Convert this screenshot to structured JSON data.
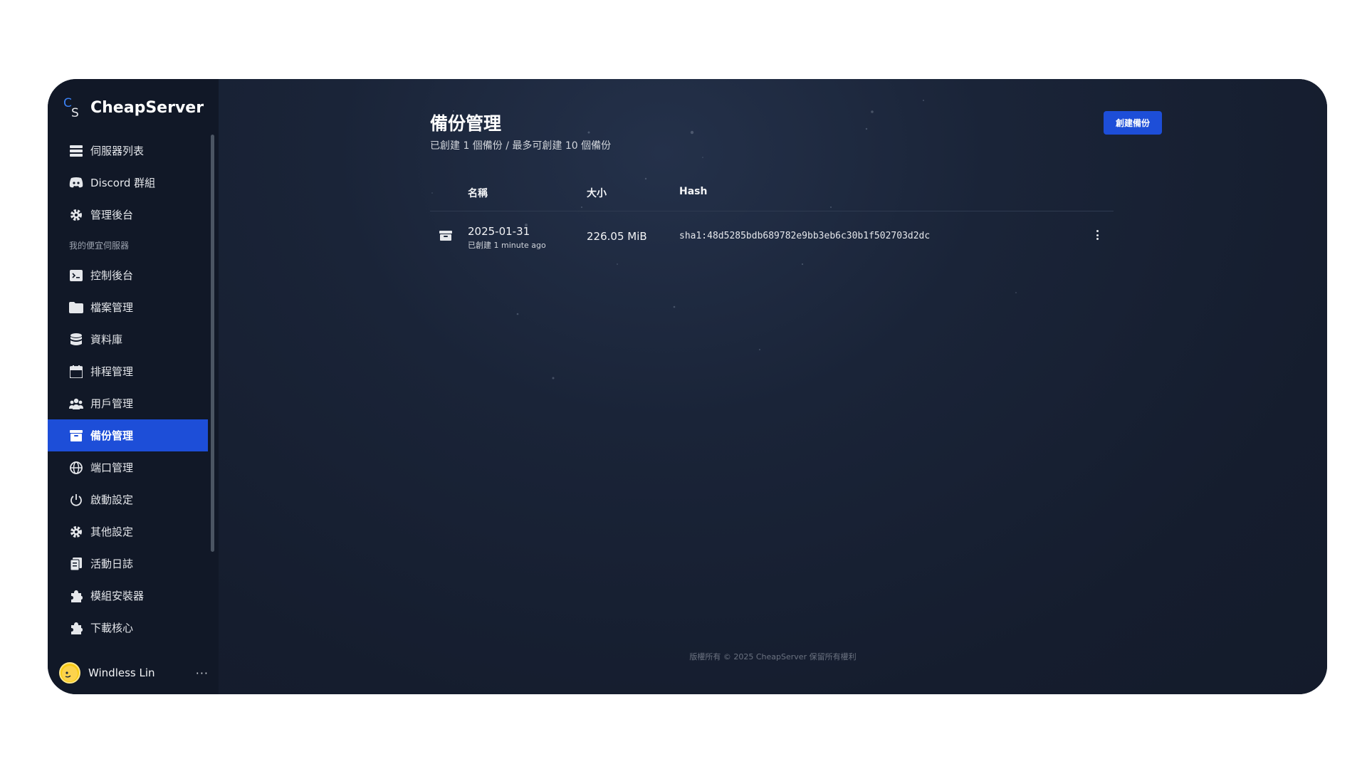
{
  "brand": {
    "name": "CheapServer",
    "logo_mark": "CS"
  },
  "sidebar": {
    "top_items": [
      {
        "label": "伺服器列表",
        "icon": "server-icon"
      },
      {
        "label": "Discord 群組",
        "icon": "discord-icon"
      },
      {
        "label": "管理後台",
        "icon": "gear-icon"
      }
    ],
    "section_label": "我的便宜伺服器",
    "items": [
      {
        "label": "控制後台",
        "icon": "terminal-icon"
      },
      {
        "label": "檔案管理",
        "icon": "folder-icon"
      },
      {
        "label": "資料庫",
        "icon": "database-icon"
      },
      {
        "label": "排程管理",
        "icon": "calendar-icon"
      },
      {
        "label": "用戶管理",
        "icon": "users-icon"
      },
      {
        "label": "備份管理",
        "icon": "archive-icon",
        "active": true
      },
      {
        "label": "端口管理",
        "icon": "globe-icon"
      },
      {
        "label": "啟動設定",
        "icon": "power-icon"
      },
      {
        "label": "其他設定",
        "icon": "gear-icon"
      },
      {
        "label": "活動日誌",
        "icon": "clipboard-icon"
      },
      {
        "label": "模組安裝器",
        "icon": "puzzle-icon"
      },
      {
        "label": "下載核心",
        "icon": "puzzle-icon"
      }
    ],
    "user": {
      "name": "Windless Lin",
      "more": "···"
    }
  },
  "main": {
    "title": "備份管理",
    "subtitle": "已創建 1 個備份 / 最多可創建 10 個備份",
    "create_button": "創建備份",
    "table": {
      "headers": {
        "name": "名稱",
        "size": "大小",
        "hash": "Hash"
      },
      "rows": [
        {
          "name": "2025-01-31",
          "created": "已創建 1 minute ago",
          "size": "226.05 MiB",
          "hash": "sha1:48d5285bdb689782e9bb3eb6c30b1f502703d2dc"
        }
      ]
    },
    "footer": "版權所有 © 2025 CheapServer 保留所有權利"
  },
  "colors": {
    "accent": "#1d4ed8",
    "sidebar_bg": "#111827",
    "main_bg": "#151c2d"
  }
}
